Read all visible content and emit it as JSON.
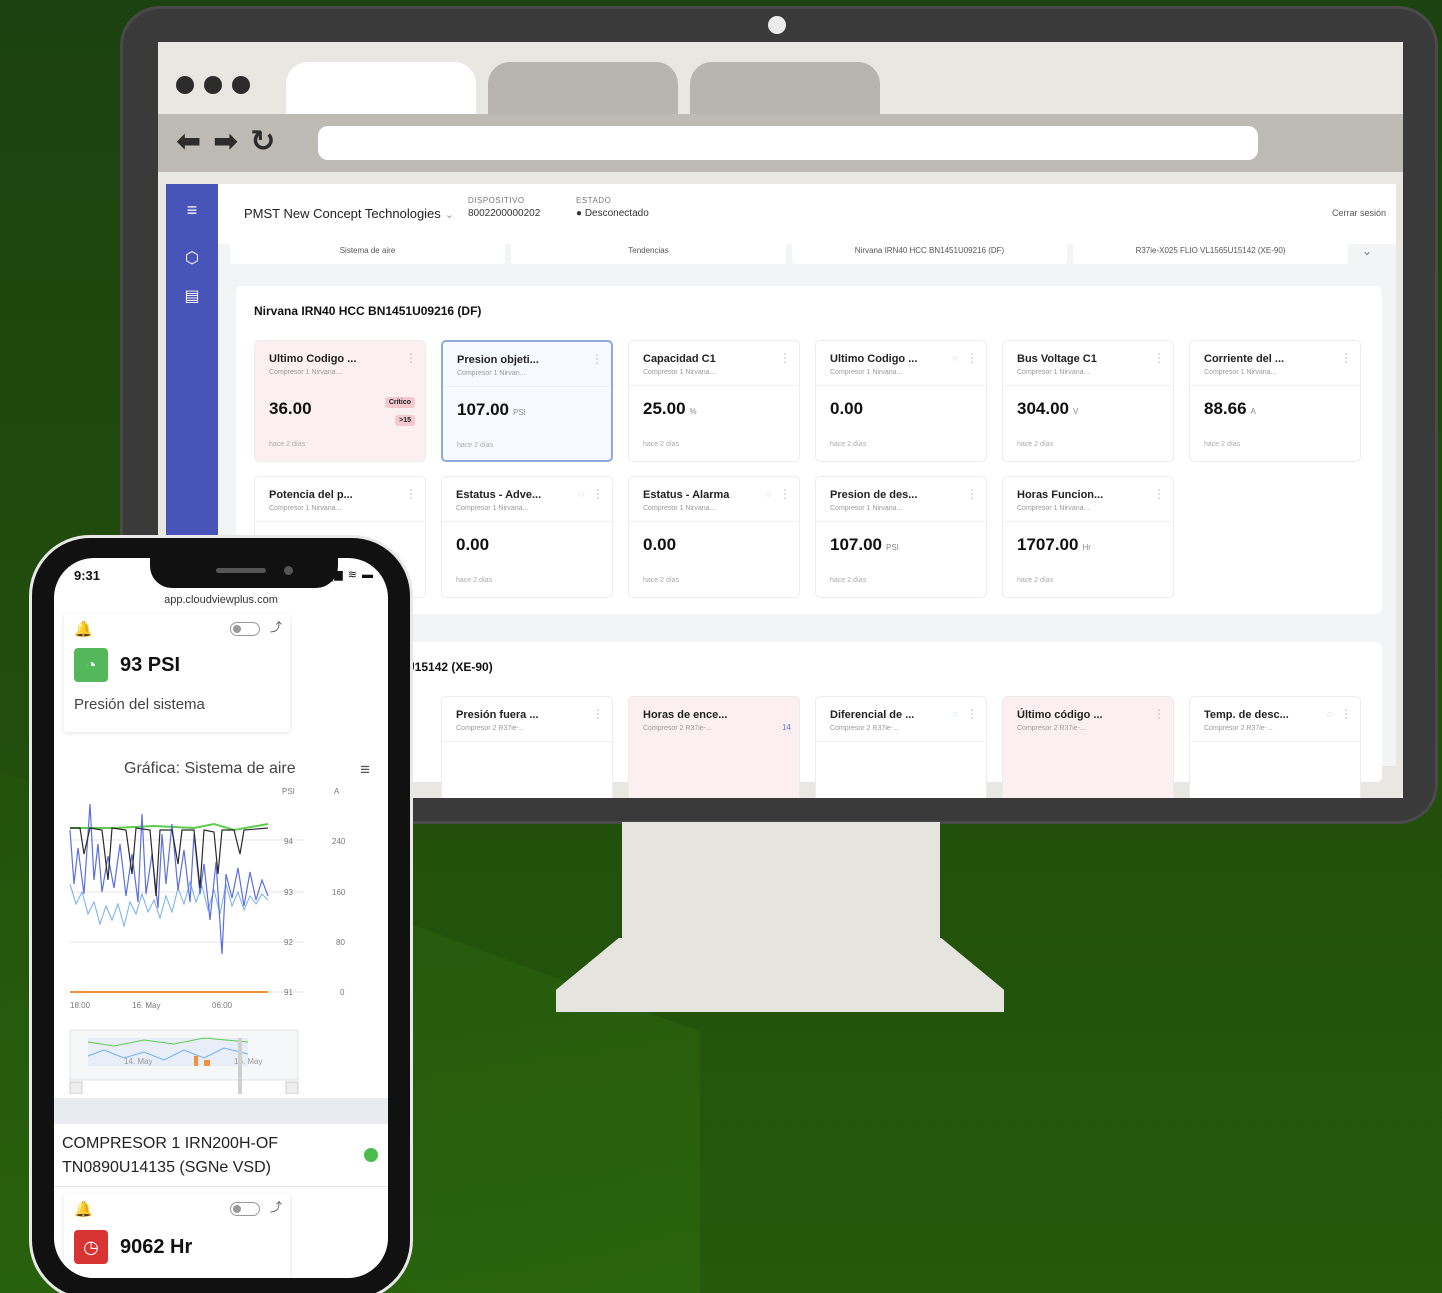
{
  "monitor": {
    "app": {
      "company": "PMST New Concept Technologies",
      "device_label": "DISPOSITIVO",
      "device_value": "8002200000202",
      "status_label": "ESTADO",
      "status_value": "● Desconectado",
      "logout": "Cerrar sesión",
      "breadcrumbs": [
        "Sistema de aire",
        "Tendencias",
        "Nirvana IRN40 HCC BN1451U09216 (DF)",
        "R37ie-X025 FLIO VL1565U15142 (XE-90)"
      ],
      "panel1": {
        "title": "Nirvana IRN40 HCC BN1451U09216 (DF)",
        "cards": [
          {
            "title": "Ultimo Codigo ...",
            "sub": "Compresor 1 Nirvana...",
            "value": "36.00",
            "unit": "",
            "time": "hace 2 días",
            "badge1": "Crítico",
            "badge2": ">15"
          },
          {
            "title": "Presion objeti...",
            "sub": "Compresor 1 Nirvan...",
            "value": "107.00",
            "unit": "PSI",
            "time": "hace 2 días"
          },
          {
            "title": "Capacidad C1",
            "sub": "Compresor 1 Nirvana...",
            "value": "25.00",
            "unit": "%",
            "time": "hace 2 días"
          },
          {
            "title": "Ultimo Codigo ...",
            "sub": "Compresor 1 Nirvana...",
            "value": "0.00",
            "unit": "",
            "time": "hace 2 días"
          },
          {
            "title": "Bus Voltage C1",
            "sub": "Compresor 1 Nirvana...",
            "value": "304.00",
            "unit": "V",
            "time": "hace 2 días"
          },
          {
            "title": "Corriente del ...",
            "sub": "Compresor 1 Nirvana...",
            "value": "88.66",
            "unit": "A",
            "time": "hace 2 días"
          },
          {
            "title": "Potencia del p...",
            "sub": "Compresor 1 Nirvana...",
            "value": "",
            "unit": "",
            "time": ""
          },
          {
            "title": "Estatus - Adve...",
            "sub": "Compresor 1 Nirvana...",
            "value": "0.00",
            "unit": "",
            "time": "hace 2 días"
          },
          {
            "title": "Estatus - Alarma",
            "sub": "Compresor 1 Nirvana...",
            "value": "0.00",
            "unit": "",
            "time": "hace 2 días"
          },
          {
            "title": "Presion de des...",
            "sub": "Compresor 1 Nirvana...",
            "value": "107.00",
            "unit": "PSI",
            "time": "hace 2 días"
          },
          {
            "title": "Horas Funcion...",
            "sub": "Compresor 1 Nirvana...",
            "value": "1707.00",
            "unit": "Hr",
            "time": "hace 2 días"
          }
        ]
      },
      "panel2": {
        "title": "U15142 (XE-90)",
        "cards": [
          {
            "title": "Presión fuera ...",
            "sub": "Compresor 2 R37ie-..."
          },
          {
            "title": "Horas de ence...",
            "sub": "Compresor 2 R37ie-...",
            "extra": "14"
          },
          {
            "title": "Diferencial de ...",
            "sub": "Compresor 2 R37ie-..."
          },
          {
            "title": "Último código ...",
            "sub": "Compresor 2 R37ie-..."
          },
          {
            "title": "Temp. de desc...",
            "sub": "Compresor 2 R37ie-..."
          }
        ]
      }
    }
  },
  "phone": {
    "time": "9:31",
    "status_icons": "▂▄▆ ≋ ▬",
    "url": "app.cloudviewplus.com",
    "card1": {
      "value": "93 PSI",
      "label": "Presión del sistema"
    },
    "chart_title": "Gráfica: Sistema de aire",
    "axis_left_unit": "PSI",
    "axis_right_unit": "A",
    "left_ticks": [
      "94",
      "93",
      "92",
      "91"
    ],
    "right_ticks": [
      "240",
      "160",
      "80",
      "0"
    ],
    "x_ticks": [
      "18:00",
      "16. May",
      "06:00"
    ],
    "nav_labels": [
      "14. May",
      "16. May"
    ],
    "compressor_line1": "COMPRESOR 1 IRN200H-OF",
    "compressor_line2": "TN0890U14135 (SGNe VSD)",
    "card2": {
      "value": "9062 Hr"
    }
  },
  "colors": {
    "sidebar": "#4954b8",
    "background": "#214e0c",
    "ok_badge": "#4cbb4c",
    "alert_badge": "#d93434",
    "series_blue": "#5b6fe0",
    "series_lightblue": "#72aef0",
    "series_black": "#2a2a2a",
    "series_green": "#5ccc4a",
    "series_orange": "#f2913a"
  }
}
